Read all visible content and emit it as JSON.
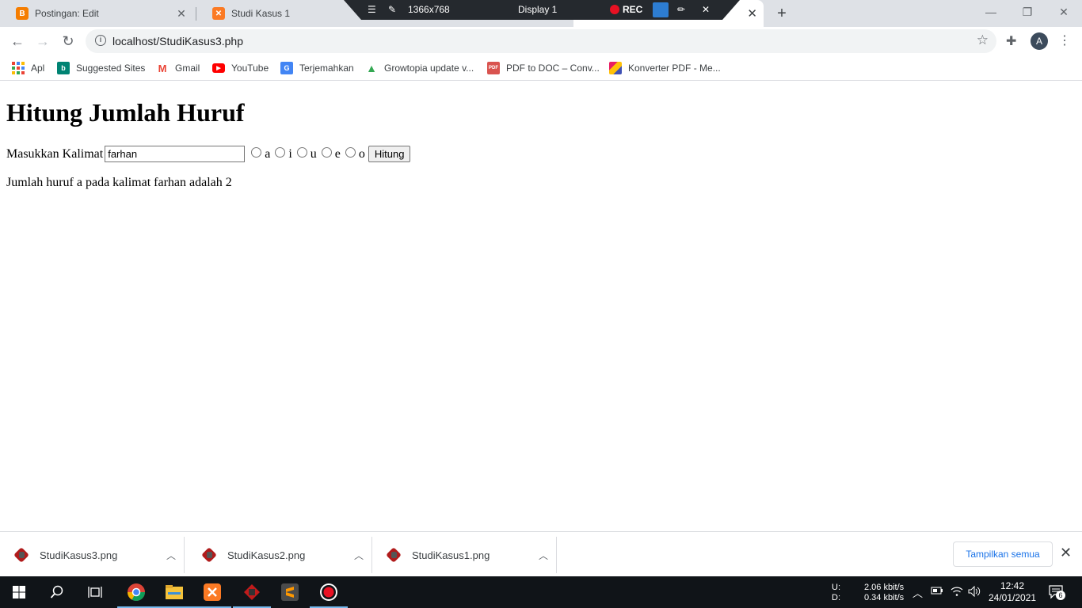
{
  "browser": {
    "tabs": [
      {
        "title": "Postingan: Edit",
        "icon": "blogger-icon",
        "color": "#f57d00"
      },
      {
        "title": "Studi Kasus 1",
        "icon": "xampp-icon",
        "color": "#fb7a24"
      }
    ],
    "close_glyph": "✕",
    "new_tab_glyph": "+",
    "url": "localhost/StudiKasus3.php",
    "avatar_letter": "A"
  },
  "recorder": {
    "resolution": "1366x768",
    "display": "Display 1",
    "rec_label": "REC"
  },
  "bookmarks": [
    {
      "label": "Apl",
      "icon": "apps-icon"
    },
    {
      "label": "Suggested Sites",
      "icon": "bing-icon",
      "color": "#008373"
    },
    {
      "label": "Gmail",
      "icon": "gmail-icon",
      "color": "#ea4335"
    },
    {
      "label": "YouTube",
      "icon": "youtube-icon",
      "color": "#ff0000"
    },
    {
      "label": "Terjemahkan",
      "icon": "translate-icon",
      "color": "#4285f4"
    },
    {
      "label": "Growtopia update v...",
      "icon": "growtopia-icon",
      "color": "#34a853"
    },
    {
      "label": "PDF to DOC – Conv...",
      "icon": "pdf-icon",
      "color": "#d9534f",
      "icon_text": "PDF"
    },
    {
      "label": "Konverter PDF - Me...",
      "icon": "konverter-icon",
      "color": "#e91e63"
    }
  ],
  "page": {
    "heading": "Hitung Jumlah Huruf",
    "input_label": "Masukkan Kalimat",
    "input_value": "farhan",
    "radios": [
      "a",
      "i",
      "u",
      "e",
      "o"
    ],
    "button_label": "Hitung",
    "result": "Jumlah huruf a pada kalimat farhan adalah 2"
  },
  "downloads": {
    "items": [
      "StudiKasus3.png",
      "StudiKasus2.png",
      "StudiKasus1.png"
    ],
    "show_all": "Tampilkan semua"
  },
  "taskbar": {
    "upload_label": "U:",
    "download_label": "D:",
    "upload_speed": "2.06 kbit/s",
    "download_speed": "0.34 kbit/s",
    "time": "12:42",
    "date": "24/01/2021",
    "notification_count": "6"
  }
}
